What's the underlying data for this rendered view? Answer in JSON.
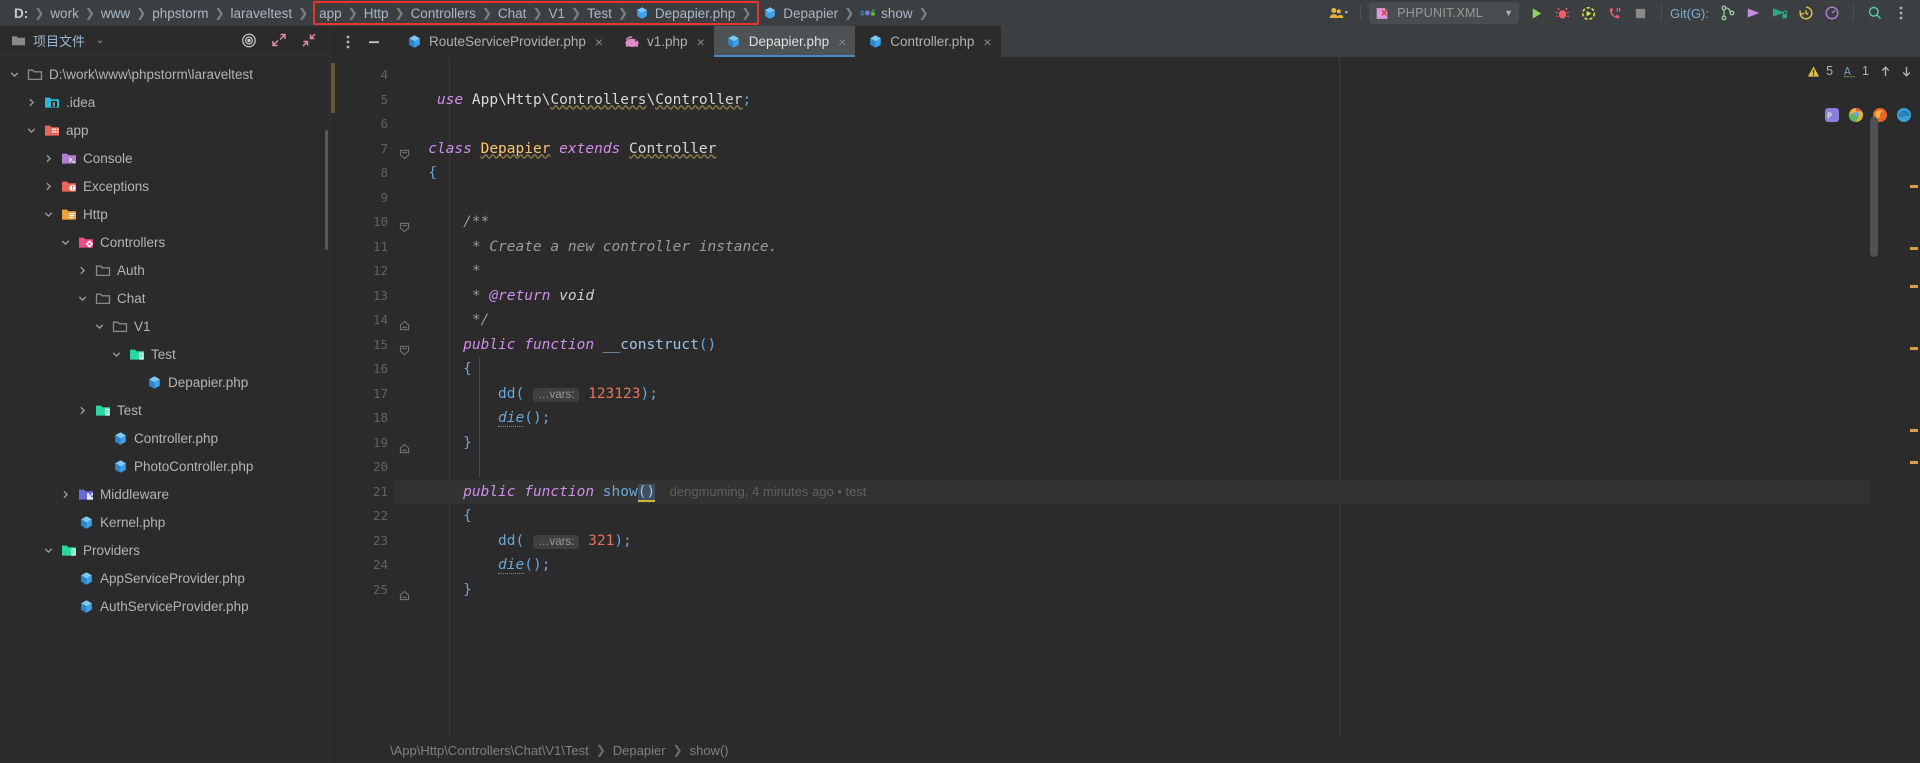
{
  "topbar": {
    "path_crumbs": [
      {
        "label": "D:",
        "bold": true
      },
      {
        "label": "work",
        "bold": false
      },
      {
        "label": "www",
        "bold": false
      },
      {
        "label": "phpstorm",
        "bold": false
      },
      {
        "label": "laraveltest",
        "bold": false
      }
    ],
    "highlighted_crumbs": [
      {
        "label": "app",
        "icon": ""
      },
      {
        "label": "Http",
        "icon": ""
      },
      {
        "label": "Controllers",
        "icon": ""
      },
      {
        "label": "Chat",
        "icon": ""
      },
      {
        "label": "V1",
        "icon": ""
      },
      {
        "label": "Test",
        "icon": ""
      },
      {
        "label": "Depapier.php",
        "icon": "php-class-icon"
      }
    ],
    "trailing_crumbs": [
      {
        "label": "Depapier",
        "icon": "php-class-icon"
      },
      {
        "label": "show",
        "icon": "php-method-public-icon"
      }
    ],
    "run_config": "PHPUNIT.XML",
    "git_label": "Git(G):",
    "icons": {
      "collaborate": "people-icon",
      "run": "run-icon",
      "debug": "debug-icon",
      "coverage": "coverage-icon",
      "profile": "profile-icon",
      "stop": "stop-icon",
      "branch": "git-branch-icon",
      "update": "git-update-icon",
      "commit": "git-commit-icon",
      "history": "git-history-icon",
      "rollback": "git-rollback-icon",
      "search": "search-icon",
      "more": "more-vertical-icon"
    }
  },
  "sidebar": {
    "title": "项目文件",
    "header_icons": {
      "folder": "folder-icon",
      "chevron": "chevron-down-icon",
      "locate": "target-icon",
      "expand": "expand-icon",
      "collapse": "collapse-icon"
    },
    "tree": [
      {
        "label": "D:\\work\\www\\phpstorm\\laraveltest",
        "depth": 0,
        "arrow": "down",
        "icon": "folder-plain-icon",
        "iconcolor": "#8a8a8a"
      },
      {
        "label": ".idea",
        "depth": 1,
        "arrow": "right",
        "icon": "folder-idea-icon",
        "iconcolor": "#2fb8d9"
      },
      {
        "label": "app",
        "depth": 1,
        "arrow": "down",
        "icon": "folder-app-icon",
        "iconcolor": "#e8685a"
      },
      {
        "label": "Console",
        "depth": 2,
        "arrow": "right",
        "icon": "folder-console-icon",
        "iconcolor": "#b07fd0"
      },
      {
        "label": "Exceptions",
        "depth": 2,
        "arrow": "right",
        "icon": "folder-exceptions-icon",
        "iconcolor": "#e8685a"
      },
      {
        "label": "Http",
        "depth": 2,
        "arrow": "down",
        "icon": "folder-http-icon",
        "iconcolor": "#e8a33d"
      },
      {
        "label": "Controllers",
        "depth": 3,
        "arrow": "down",
        "icon": "folder-controllers-icon",
        "iconcolor": "#ef4a8a"
      },
      {
        "label": "Auth",
        "depth": 4,
        "arrow": "right",
        "icon": "folder-plain-icon",
        "iconcolor": "#8a8a8a"
      },
      {
        "label": "Chat",
        "depth": 4,
        "arrow": "down",
        "icon": "folder-open-icon",
        "iconcolor": "#8a8a8a"
      },
      {
        "label": "V1",
        "depth": 5,
        "arrow": "down",
        "icon": "folder-open-icon",
        "iconcolor": "#8a8a8a"
      },
      {
        "label": "Test",
        "depth": 6,
        "arrow": "down",
        "icon": "folder-test-icon",
        "iconcolor": "#28d8a0"
      },
      {
        "label": "Depapier.php",
        "depth": 7,
        "arrow": "none",
        "icon": "php-class-icon",
        "iconcolor": "#3fa0e8"
      },
      {
        "label": "Test",
        "depth": 4,
        "arrow": "right",
        "icon": "folder-test-icon",
        "iconcolor": "#28d8a0"
      },
      {
        "label": "Controller.php",
        "depth": 5,
        "arrow": "none",
        "icon": "php-class-icon",
        "iconcolor": "#3fa0e8"
      },
      {
        "label": "PhotoController.php",
        "depth": 5,
        "arrow": "none",
        "icon": "php-class-icon",
        "iconcolor": "#3fa0e8"
      },
      {
        "label": "Middleware",
        "depth": 3,
        "arrow": "right",
        "icon": "folder-middleware-icon",
        "iconcolor": "#6a6ae0"
      },
      {
        "label": "Kernel.php",
        "depth": 3,
        "arrow": "none",
        "icon": "php-class-icon",
        "iconcolor": "#3fa0e8"
      },
      {
        "label": "Providers",
        "depth": 2,
        "arrow": "down",
        "icon": "folder-providers-icon",
        "iconcolor": "#28d8a0"
      },
      {
        "label": "AppServiceProvider.php",
        "depth": 3,
        "arrow": "none",
        "icon": "php-class-icon",
        "iconcolor": "#3fa0e8"
      },
      {
        "label": "AuthServiceProvider.php",
        "depth": 3,
        "arrow": "none",
        "icon": "php-class-icon",
        "iconcolor": "#3fa0e8"
      }
    ]
  },
  "tabs": {
    "tools": {
      "more": "more-vertical-icon",
      "minimize": "minimize-icon"
    },
    "items": [
      {
        "label": "RouteServiceProvider.php",
        "icon": "php-class-icon",
        "active": false,
        "close": "×"
      },
      {
        "label": "v1.php",
        "icon": "php-file-icon",
        "active": false,
        "close": "×"
      },
      {
        "label": "Depapier.php",
        "icon": "php-class-icon",
        "active": true,
        "close": "×"
      },
      {
        "label": "Controller.php",
        "icon": "php-class-icon",
        "active": false,
        "close": "×"
      }
    ]
  },
  "editor": {
    "first_line_number": 4,
    "line_numbers": [
      4,
      5,
      6,
      7,
      8,
      9,
      10,
      11,
      12,
      13,
      14,
      15,
      16,
      17,
      18,
      19,
      20,
      21,
      22,
      23,
      24,
      25
    ],
    "blame_annotation": "dengmuming, 4 minutes ago • test",
    "inspection": {
      "warning_count": "5",
      "typo_count": "1",
      "warning_icon": "warning-triangle-icon",
      "typo_icon": "typo-icon",
      "prev_icon": "arrow-up-icon",
      "next_icon": "arrow-down-icon"
    },
    "lines": [
      {
        "n": 4,
        "text": ""
      },
      {
        "n": 5,
        "text": "use App\\Http\\Controllers\\Controller;"
      },
      {
        "n": 6,
        "text": ""
      },
      {
        "n": 7,
        "text": "class Depapier extends Controller"
      },
      {
        "n": 8,
        "text": "{"
      },
      {
        "n": 9,
        "text": ""
      },
      {
        "n": 10,
        "text": "    /**"
      },
      {
        "n": 11,
        "text": "     * Create a new controller instance."
      },
      {
        "n": 12,
        "text": "     *"
      },
      {
        "n": 13,
        "text": "     * @return void"
      },
      {
        "n": 14,
        "text": "     */"
      },
      {
        "n": 15,
        "text": "    public function __construct()"
      },
      {
        "n": 16,
        "text": "    {"
      },
      {
        "n": 17,
        "text": "        dd( ...vars: 123123);"
      },
      {
        "n": 18,
        "text": "        die();"
      },
      {
        "n": 19,
        "text": "    }"
      },
      {
        "n": 20,
        "text": ""
      },
      {
        "n": 21,
        "text": "    public function show()"
      },
      {
        "n": 22,
        "text": "    {"
      },
      {
        "n": 23,
        "text": "        dd( ...vars: 321);"
      },
      {
        "n": 24,
        "text": "        die();"
      },
      {
        "n": 25,
        "text": "    }"
      }
    ],
    "param_hint_label": "…vars:"
  },
  "statusbar": {
    "crumbs": [
      "\\App\\Http\\Controllers\\Chat\\V1\\Test",
      "Depapier",
      "show()"
    ]
  },
  "colors": {
    "accent_red": "#e8342a",
    "tab_active_underline": "#4a88c7",
    "keyword": "#cf8ee8",
    "class_name": "#ffc66d",
    "number": "#e8735a",
    "comment": "#808080",
    "bg": "#2b2b2b",
    "chrome_bg": "#3c3f41"
  }
}
